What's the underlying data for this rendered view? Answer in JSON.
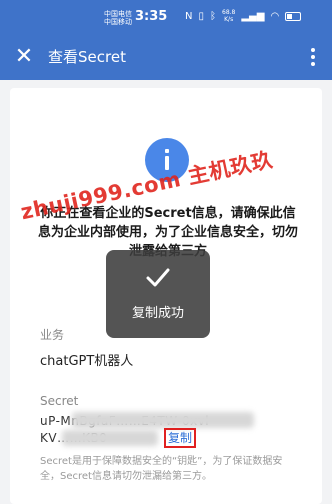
{
  "statusbar": {
    "carrier_line1": "中国电信",
    "carrier_line2": "中国移动",
    "time": "3:35",
    "net_speed": "68.8",
    "net_unit": "K/s",
    "icon_names": [
      "nfc-icon",
      "bluetooth-icon",
      "vibrate-icon",
      "signal-icon",
      "wifi-icon",
      "battery-icon"
    ]
  },
  "appbar": {
    "title": "查看Secret",
    "background": "#3f73c9"
  },
  "notice": {
    "text": "你正在查看企业的Secret信息，请确保此信息为企业内部使用，为了企业信息安全，切勿泄露给第三方"
  },
  "watermark": {
    "text": "zhuji999.com 主机玖玖"
  },
  "toast": {
    "text": "复制成功"
  },
  "fields": {
    "app_label": "业务",
    "app_value": "chatGPT机器人",
    "secret_label": "Secret",
    "secret_line1": "uP-MnBgfaF……E4TW-0xvl",
    "secret_line2": "KV……KB0",
    "copy_label": "复制",
    "hint": "Secret是用于保障数据安全的“钥匙”，为了保证数据安全，Secret信息请切勿泄漏给第三方。"
  },
  "colors": {
    "accent": "#3f73c9",
    "info_icon": "#4a87e8",
    "link": "#2f6fd6",
    "highlight_border": "#e02020"
  }
}
